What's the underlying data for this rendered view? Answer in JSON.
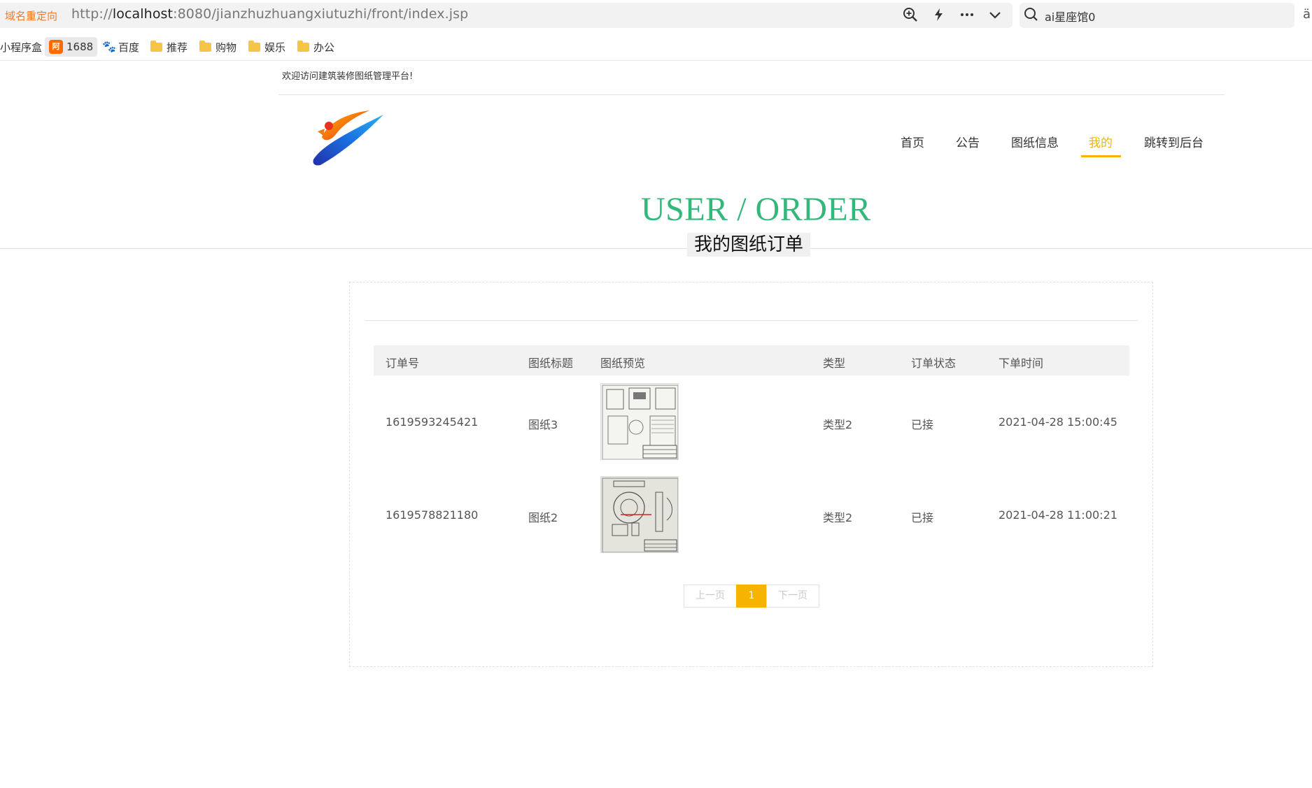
{
  "browser": {
    "redirect_label": "域名重定向",
    "url_prefix": "http://",
    "url_host": "localhost",
    "url_rest": ":8080/jianzhuzhuangxiutuzhi/front/index.jsp",
    "search_text": "ai星座馆0",
    "bookmarks": [
      "小程序盒",
      "1688",
      "百度",
      "推荐",
      "购物",
      "娱乐",
      "办公"
    ]
  },
  "header": {
    "welcome": "欢迎访问建筑装修图纸管理平台!",
    "nav": [
      "首页",
      "公告",
      "图纸信息",
      "我的",
      "跳转到后台"
    ],
    "active_nav": "我的"
  },
  "section": {
    "title_en": "USER / ORDER",
    "title_cn": "我的图纸订单"
  },
  "table": {
    "columns": [
      "订单号",
      "图纸标题",
      "图纸预览",
      "类型",
      "订单状态",
      "下单时间"
    ],
    "rows": [
      {
        "order_no": "1619593245421",
        "title": "图纸3",
        "type": "类型2",
        "status": "已接",
        "time": "2021-04-28 15:00:45"
      },
      {
        "order_no": "1619578821180",
        "title": "图纸2",
        "type": "类型2",
        "status": "已接",
        "time": "2021-04-28 11:00:21"
      }
    ]
  },
  "pagination": {
    "prev": "上一页",
    "current": "1",
    "next": "下一页"
  },
  "colors": {
    "accent": "#f6b400",
    "title_green": "#32b87a"
  }
}
